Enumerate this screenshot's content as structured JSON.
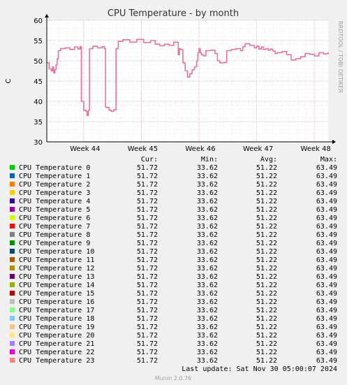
{
  "chart_data": {
    "type": "line",
    "title": "CPU Temperature - by month",
    "ylabel": "C",
    "ylim": [
      30,
      60
    ],
    "yticks": [
      30,
      35,
      40,
      45,
      50,
      55,
      60
    ],
    "xticks": [
      "Week 44",
      "Week 45",
      "Week 46",
      "Week 47",
      "Week 48"
    ],
    "grid": true,
    "watermark": "RRDTOOL / TOBI OETIKER",
    "series_color": "#e8739a",
    "series_points": [
      [
        0.0,
        49.5
      ],
      [
        0.01,
        48.0
      ],
      [
        0.02,
        47.5
      ],
      [
        0.025,
        48.5
      ],
      [
        0.03,
        47.0
      ],
      [
        0.035,
        47.8
      ],
      [
        0.04,
        49.0
      ],
      [
        0.045,
        50.5
      ],
      [
        0.05,
        52.5
      ],
      [
        0.06,
        53.0
      ],
      [
        0.08,
        53.2
      ],
      [
        0.1,
        52.8
      ],
      [
        0.12,
        53.4
      ],
      [
        0.135,
        52.9
      ],
      [
        0.145,
        53.5
      ],
      [
        0.15,
        40.0
      ],
      [
        0.16,
        37.8
      ],
      [
        0.17,
        37.5
      ],
      [
        0.175,
        36.5
      ],
      [
        0.18,
        37.8
      ],
      [
        0.185,
        53.0
      ],
      [
        0.2,
        53.6
      ],
      [
        0.22,
        53.2
      ],
      [
        0.24,
        53.5
      ],
      [
        0.25,
        53.0
      ],
      [
        0.255,
        38.5
      ],
      [
        0.27,
        37.8
      ],
      [
        0.28,
        37.5
      ],
      [
        0.29,
        37.9
      ],
      [
        0.3,
        53.0
      ],
      [
        0.31,
        54.8
      ],
      [
        0.33,
        55.2
      ],
      [
        0.36,
        54.6
      ],
      [
        0.39,
        55.3
      ],
      [
        0.42,
        54.5
      ],
      [
        0.45,
        55.0
      ],
      [
        0.47,
        54.1
      ],
      [
        0.49,
        53.7
      ],
      [
        0.51,
        54.1
      ],
      [
        0.53,
        53.8
      ],
      [
        0.55,
        54.6
      ],
      [
        0.57,
        51.5
      ],
      [
        0.575,
        53.0
      ],
      [
        0.58,
        52.8
      ],
      [
        0.59,
        49.5
      ],
      [
        0.6,
        47.5
      ],
      [
        0.61,
        46.0
      ],
      [
        0.62,
        46.8
      ],
      [
        0.63,
        47.8
      ],
      [
        0.64,
        48.5
      ],
      [
        0.65,
        50.0
      ],
      [
        0.655,
        52.0
      ],
      [
        0.66,
        53.0
      ],
      [
        0.665,
        52.0
      ],
      [
        0.67,
        51.5
      ],
      [
        0.68,
        51.2
      ],
      [
        0.69,
        52.5
      ],
      [
        0.71,
        52.6
      ],
      [
        0.73,
        51.8
      ],
      [
        0.74,
        50.0
      ],
      [
        0.75,
        49.5
      ],
      [
        0.77,
        49.6
      ],
      [
        0.78,
        52.5
      ],
      [
        0.8,
        52.8
      ],
      [
        0.82,
        53.0
      ],
      [
        0.84,
        52.5
      ],
      [
        0.85,
        53.5
      ],
      [
        0.86,
        54.2
      ],
      [
        0.88,
        53.8
      ],
      [
        0.9,
        53.2
      ],
      [
        0.91,
        53.6
      ],
      [
        0.92,
        52.9
      ],
      [
        0.93,
        53.4
      ],
      [
        0.94,
        52.8
      ],
      [
        0.95,
        53.0
      ],
      [
        0.96,
        52.6
      ],
      [
        0.97,
        52.9
      ],
      [
        0.98,
        52.4
      ],
      [
        0.99,
        51.8
      ],
      [
        1.0,
        52.0
      ],
      [
        1.02,
        52.3
      ],
      [
        1.04,
        51.5
      ],
      [
        1.06,
        50.2
      ],
      [
        1.08,
        50.5
      ],
      [
        1.1,
        51.0
      ],
      [
        1.12,
        51.8
      ],
      [
        1.14,
        51.6
      ],
      [
        1.16,
        51.2
      ],
      [
        1.18,
        52.0
      ],
      [
        1.2,
        51.7
      ],
      [
        1.22,
        52.1
      ]
    ],
    "columns": [
      "Cur:",
      "Min:",
      "Avg:",
      "Max:"
    ],
    "legend": [
      {
        "name": "CPU Temperature 0",
        "color": "#00cc00",
        "cur": "51.72",
        "min": "33.62",
        "avg": "51.22",
        "max": "63.49"
      },
      {
        "name": "CPU Temperature 1",
        "color": "#0066b3",
        "cur": "51.72",
        "min": "33.62",
        "avg": "51.22",
        "max": "63.49"
      },
      {
        "name": "CPU Temperature 2",
        "color": "#ff8000",
        "cur": "51.72",
        "min": "33.62",
        "avg": "51.22",
        "max": "63.49"
      },
      {
        "name": "CPU Temperature 3",
        "color": "#ffcc00",
        "cur": "51.72",
        "min": "33.62",
        "avg": "51.22",
        "max": "63.49"
      },
      {
        "name": "CPU Temperature 4",
        "color": "#330099",
        "cur": "51.72",
        "min": "33.62",
        "avg": "51.22",
        "max": "63.49"
      },
      {
        "name": "CPU Temperature 5",
        "color": "#990099",
        "cur": "51.72",
        "min": "33.62",
        "avg": "51.22",
        "max": "63.49"
      },
      {
        "name": "CPU Temperature 6",
        "color": "#ccff00",
        "cur": "51.72",
        "min": "33.62",
        "avg": "51.22",
        "max": "63.49"
      },
      {
        "name": "CPU Temperature 7",
        "color": "#ff0000",
        "cur": "51.72",
        "min": "33.62",
        "avg": "51.22",
        "max": "63.49"
      },
      {
        "name": "CPU Temperature 8",
        "color": "#808080",
        "cur": "51.72",
        "min": "33.62",
        "avg": "51.22",
        "max": "63.49"
      },
      {
        "name": "CPU Temperature 9",
        "color": "#008f00",
        "cur": "51.72",
        "min": "33.62",
        "avg": "51.22",
        "max": "63.49"
      },
      {
        "name": "CPU Temperature 10",
        "color": "#00487d",
        "cur": "51.72",
        "min": "33.62",
        "avg": "51.22",
        "max": "63.49"
      },
      {
        "name": "CPU Temperature 11",
        "color": "#b35a00",
        "cur": "51.72",
        "min": "33.62",
        "avg": "51.22",
        "max": "63.49"
      },
      {
        "name": "CPU Temperature 12",
        "color": "#b38f00",
        "cur": "51.72",
        "min": "33.62",
        "avg": "51.22",
        "max": "63.49"
      },
      {
        "name": "CPU Temperature 13",
        "color": "#6b006b",
        "cur": "51.72",
        "min": "33.62",
        "avg": "51.22",
        "max": "63.49"
      },
      {
        "name": "CPU Temperature 14",
        "color": "#8fb300",
        "cur": "51.72",
        "min": "33.62",
        "avg": "51.22",
        "max": "63.49"
      },
      {
        "name": "CPU Temperature 15",
        "color": "#b30000",
        "cur": "51.72",
        "min": "33.62",
        "avg": "51.22",
        "max": "63.49"
      },
      {
        "name": "CPU Temperature 16",
        "color": "#bebebe",
        "cur": "51.72",
        "min": "33.62",
        "avg": "51.22",
        "max": "63.49"
      },
      {
        "name": "CPU Temperature 17",
        "color": "#80ff80",
        "cur": "51.72",
        "min": "33.62",
        "avg": "51.22",
        "max": "63.49"
      },
      {
        "name": "CPU Temperature 18",
        "color": "#80c9ff",
        "cur": "51.72",
        "min": "33.62",
        "avg": "51.22",
        "max": "63.49"
      },
      {
        "name": "CPU Temperature 19",
        "color": "#ffc080",
        "cur": "51.72",
        "min": "33.62",
        "avg": "51.22",
        "max": "63.49"
      },
      {
        "name": "CPU Temperature 20",
        "color": "#ffe680",
        "cur": "51.72",
        "min": "33.62",
        "avg": "51.22",
        "max": "63.49"
      },
      {
        "name": "CPU Temperature 21",
        "color": "#aa80ff",
        "cur": "51.72",
        "min": "33.62",
        "avg": "51.22",
        "max": "63.49"
      },
      {
        "name": "CPU Temperature 22",
        "color": "#ee00cc",
        "cur": "51.72",
        "min": "33.62",
        "avg": "51.22",
        "max": "63.49"
      },
      {
        "name": "CPU Temperature 23",
        "color": "#ff8080",
        "cur": "51.72",
        "min": "33.62",
        "avg": "51.22",
        "max": "63.49"
      }
    ],
    "last_update": "Last update:  Sat Nov 30 05:00:07 2024",
    "footer": "Munin 2.0.76"
  }
}
